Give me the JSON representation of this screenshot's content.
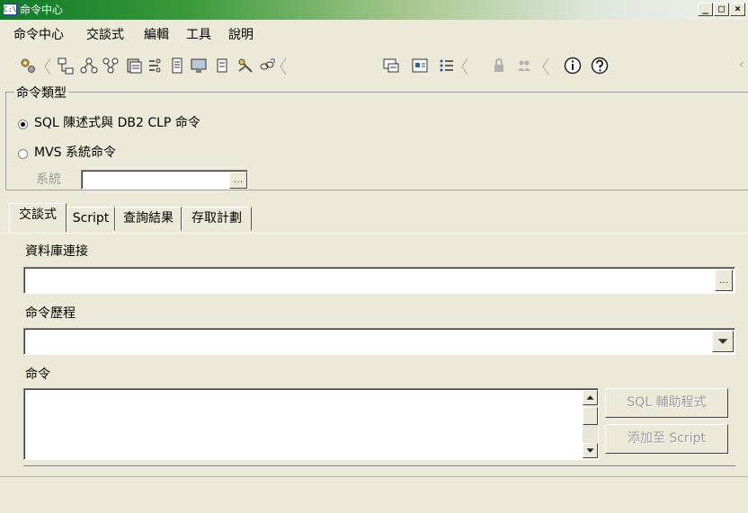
{
  "window": {
    "title": "命令中心",
    "icon": "terminal-icon",
    "controls": [
      "_",
      "□",
      "×"
    ]
  },
  "menu": [
    "命令中心",
    "交談式",
    "編輯",
    "工具",
    "說明"
  ],
  "toolbar": {
    "icons": [
      "gear-cog-icon",
      "object-tree-icon",
      "network-nodes-icon",
      "hierarchy-icon",
      "database-stack-icon",
      "flow-icon",
      "document-icon",
      "monitor-icon",
      "page-icon",
      "key-tools-icon",
      "link-chain-icon",
      "chat-bubble-icon",
      "display-panel-icon",
      "list-bullets-icon",
      "lock-icon",
      "users-icon",
      "info-icon",
      "help-icon"
    ],
    "overflow": "‹"
  },
  "command_type": {
    "legend": "命令類型",
    "option_sql": "SQL 陳述式與 DB2 CLP 命令",
    "option_mvs": "MVS 系統命令",
    "selected": "sql",
    "system_label": "系統",
    "system_value": "",
    "ellipsis": "..."
  },
  "tabs": [
    "交談式",
    "Script",
    "查詢結果",
    "存取計劃"
  ],
  "active_tab": 0,
  "interactive": {
    "db_connection_label": "資料庫連接",
    "db_connection_value": "",
    "db_ellipsis": "...",
    "history_label": "命令歷程",
    "history_value": "",
    "command_label": "命令",
    "command_value": "",
    "sql_assist_button": "SQL 輔助程式",
    "add_to_script_button": "添加至 Script"
  },
  "colors": {
    "face": "#ece9d8",
    "title_start": "#0f7a2a",
    "disabled_text": "#9a9a9a"
  }
}
